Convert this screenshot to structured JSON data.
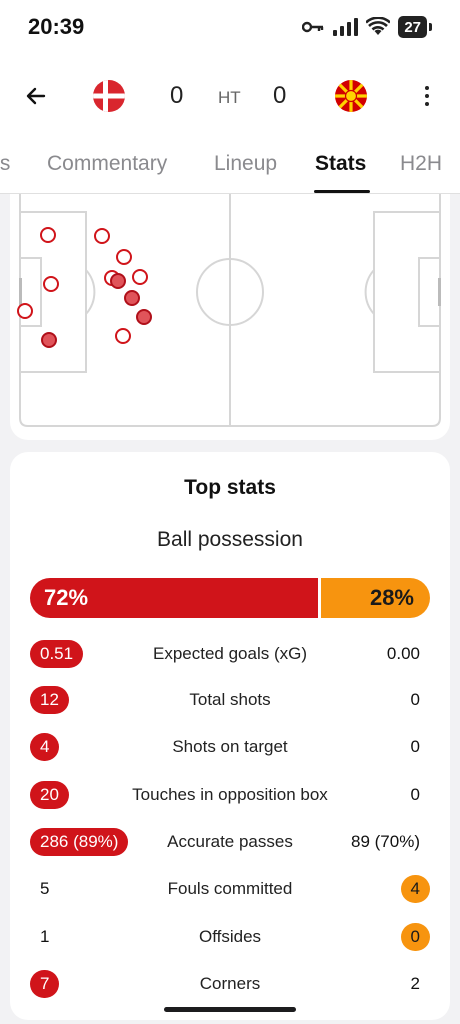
{
  "status_bar": {
    "time": "20:39",
    "battery": "27"
  },
  "header": {
    "home_score": "0",
    "away_score": "0",
    "period": "HT",
    "home_team_flag": "denmark-flag",
    "away_team_flag": "north-macedonia-flag"
  },
  "tabs": [
    {
      "label": "ts",
      "active": false
    },
    {
      "label": "Commentary",
      "active": false
    },
    {
      "label": "Lineup",
      "active": false
    },
    {
      "label": "Stats",
      "active": true
    },
    {
      "label": "H2H",
      "active": false
    }
  ],
  "shot_map": {
    "shots": [
      {
        "on_target": false
      },
      {
        "on_target": false
      },
      {
        "on_target": false
      },
      {
        "on_target": false
      },
      {
        "on_target": false
      },
      {
        "on_target": false
      },
      {
        "on_target": false
      },
      {
        "on_target": false
      },
      {
        "on_target": true
      },
      {
        "on_target": true
      },
      {
        "on_target": true
      },
      {
        "on_target": true
      }
    ]
  },
  "top_stats": {
    "title": "Top stats",
    "possession": {
      "label": "Ball possession",
      "home": "72%",
      "away": "28%",
      "home_fraction": 0.72
    },
    "rows": [
      {
        "label": "Expected goals (xG)",
        "home": "0.51",
        "away": "0.00",
        "highlight": "home"
      },
      {
        "label": "Total shots",
        "home": "12",
        "away": "0",
        "highlight": "home"
      },
      {
        "label": "Shots on target",
        "home": "4",
        "away": "0",
        "highlight": "home"
      },
      {
        "label": "Touches in opposition box",
        "home": "20",
        "away": "0",
        "highlight": "home"
      },
      {
        "label": "Accurate passes",
        "home": "286 (89%)",
        "away": "89 (70%)",
        "highlight": "home"
      },
      {
        "label": "Fouls committed",
        "home": "5",
        "away": "4",
        "highlight": "away"
      },
      {
        "label": "Offsides",
        "home": "1",
        "away": "0",
        "highlight": "away"
      },
      {
        "label": "Corners",
        "home": "7",
        "away": "2",
        "highlight": "home"
      }
    ]
  },
  "colors": {
    "home": "#d0141a",
    "away": "#f7940f"
  }
}
